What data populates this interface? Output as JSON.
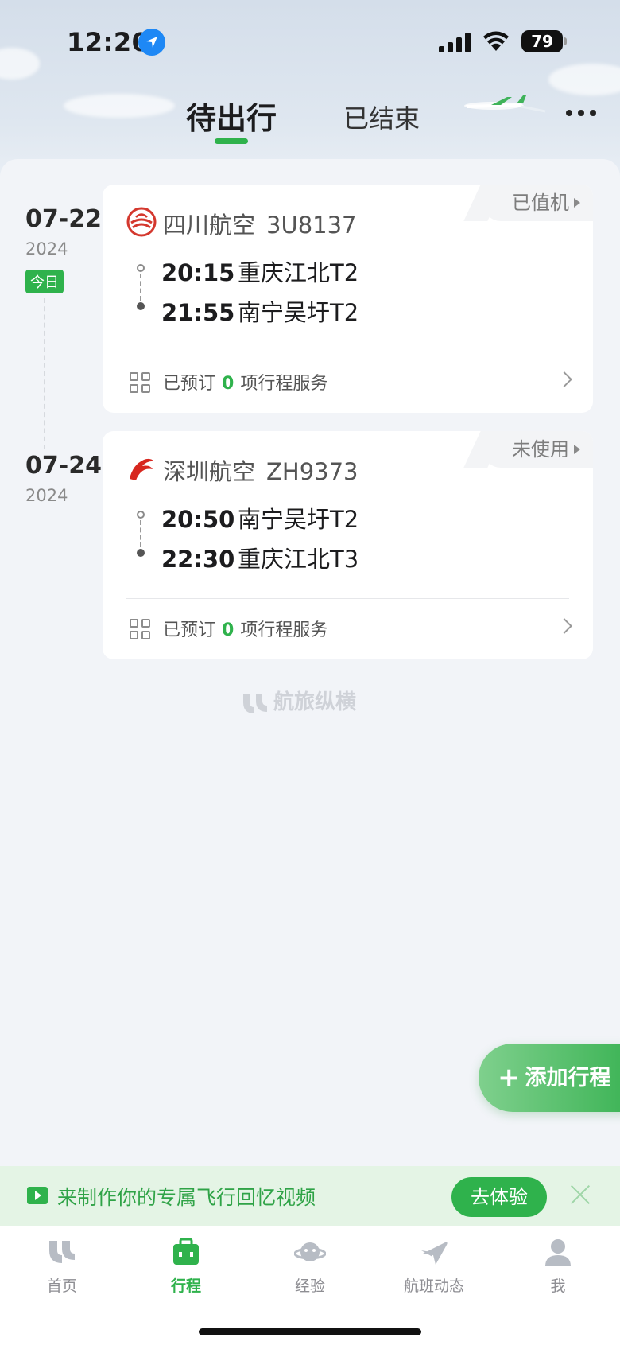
{
  "status_bar": {
    "time": "12:20",
    "battery": "79"
  },
  "tabs": {
    "active": "待出行",
    "inactive": "已结束"
  },
  "trips": [
    {
      "date": "07-22",
      "year": "2024",
      "badge": "今日",
      "status": "已值机",
      "airline": "四川航空",
      "flight_no": "3U8137",
      "dep_time": "20:15",
      "dep_airport": "重庆江北T2",
      "arr_time": "21:55",
      "arr_airport": "南宁吴圩T2",
      "services_prefix": "已预订",
      "services_count": "0",
      "services_suffix": "项行程服务"
    },
    {
      "date": "07-24",
      "year": "2024",
      "status": "未使用",
      "airline": "深圳航空",
      "flight_no": "ZH9373",
      "dep_time": "20:50",
      "dep_airport": "南宁吴圩T2",
      "arr_time": "22:30",
      "arr_airport": "重庆江北T3",
      "services_prefix": "已预订",
      "services_count": "0",
      "services_suffix": "项行程服务"
    }
  ],
  "brand": "航旅纵横",
  "fab": {
    "label": "添加行程"
  },
  "promo": {
    "text": "来制作你的专属飞行回忆视频",
    "button": "去体验"
  },
  "tabbar": [
    {
      "label": "首页",
      "icon": "home-icon"
    },
    {
      "label": "行程",
      "icon": "briefcase-icon"
    },
    {
      "label": "经验",
      "icon": "planet-icon"
    },
    {
      "label": "航班动态",
      "icon": "plane-icon"
    },
    {
      "label": "我",
      "icon": "user-icon"
    }
  ],
  "colors": {
    "accent": "#2fb24c",
    "background": "#f2f4f8"
  }
}
